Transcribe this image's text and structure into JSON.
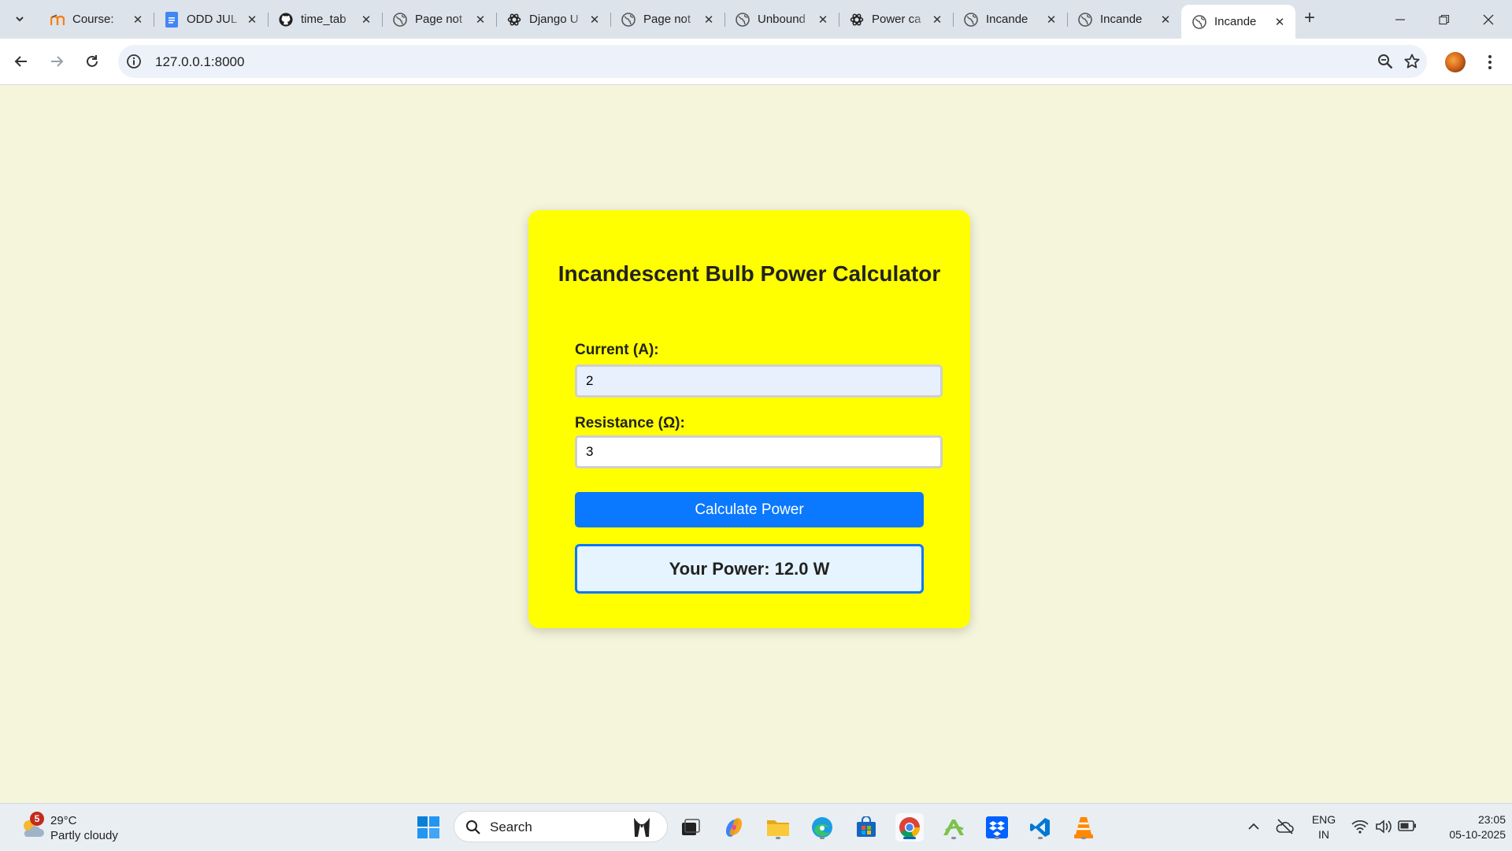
{
  "browser": {
    "tabs": [
      {
        "title": "Course:",
        "icon": "moodle-icon"
      },
      {
        "title": "ODD JUL",
        "icon": "google-docs-icon"
      },
      {
        "title": "time_tab",
        "icon": "github-icon"
      },
      {
        "title": "Page not",
        "icon": "globe-icon"
      },
      {
        "title": "Django U",
        "icon": "chatgpt-icon"
      },
      {
        "title": "Page not",
        "icon": "globe-icon"
      },
      {
        "title": "Unbound",
        "icon": "globe-icon"
      },
      {
        "title": "Power ca",
        "icon": "chatgpt-icon"
      },
      {
        "title": "Incande",
        "icon": "globe-icon"
      },
      {
        "title": "Incande",
        "icon": "globe-icon"
      },
      {
        "title": "Incande",
        "icon": "globe-icon",
        "active": true
      }
    ],
    "url": "127.0.0.1:8000"
  },
  "app": {
    "title": "Incandescent Bulb Power Calculator",
    "current_label": "Current (A):",
    "current_value": "2",
    "resistance_label": "Resistance (Ω):",
    "resistance_value": "3",
    "button_label": "Calculate Power",
    "result_text": "Your Power: 12.0 W"
  },
  "taskbar": {
    "weather": {
      "badge": "5",
      "temperature": "29°C",
      "condition": "Partly cloudy"
    },
    "search_label": "Search",
    "language": "ENG",
    "region": "IN",
    "time": "23:05",
    "date": "05-10-2025"
  },
  "colors": {
    "page_background": "#f5f5dc",
    "card_background": "#ffff00",
    "button_blue": "#0a78ff",
    "result_background": "#e6f4ff"
  }
}
